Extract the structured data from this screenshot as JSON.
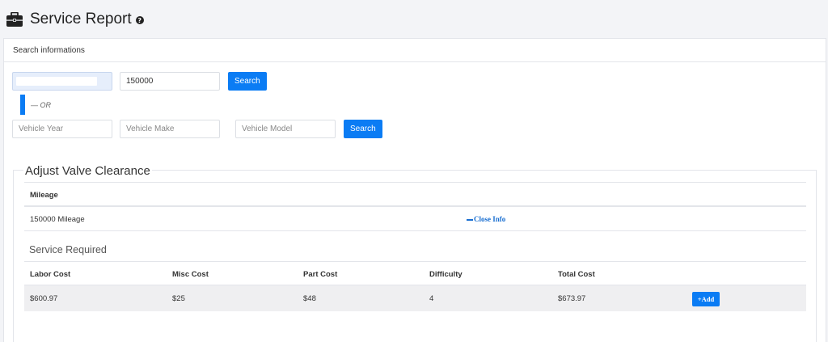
{
  "header": {
    "title": "Service Report",
    "help_symbol": "?",
    "icon": "briefcase-icon"
  },
  "search": {
    "section_label": "Search informations",
    "mileage_value": "150000",
    "search_label_1": "Search",
    "or_text": "— OR",
    "vehicle_year_placeholder": "Vehicle Year",
    "vehicle_make_placeholder": "Vehicle Make",
    "vehicle_model_placeholder": "Vehicle Model",
    "search_label_2": "Search"
  },
  "service": {
    "name": "Adjust Valve Clearance",
    "mileage_header": "Mileage",
    "mileage_value": "150000 Mileage",
    "close_info": "Close Info",
    "required_title": "Service Required",
    "columns": [
      "Labor Cost",
      "Misc Cost",
      "Part Cost",
      "Difficulty",
      "Total Cost"
    ],
    "rows": [
      {
        "labor": "$600.97",
        "misc": "$25",
        "part": "$48",
        "difficulty": "4",
        "total": "$673.97",
        "action": "+Add"
      }
    ]
  },
  "colors": {
    "primary": "#0b7cf4",
    "link": "#1a6fd1",
    "background": "#f3f4f7"
  }
}
